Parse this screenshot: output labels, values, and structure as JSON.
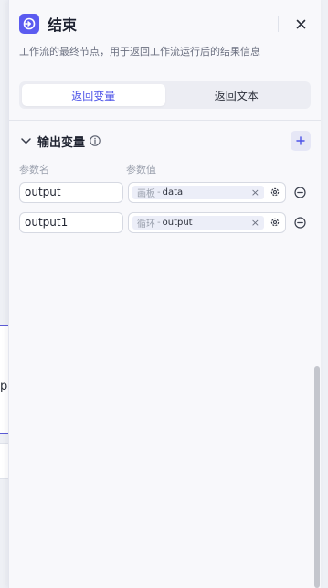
{
  "background": {
    "node_fragment_text": "p"
  },
  "panel": {
    "title": "结束",
    "description": "工作流的最终节点，用于返回工作流运行后的结果信息",
    "close_icon": "close-icon",
    "node_icon": "exit-node-icon",
    "accent_color": "#5b5bf0"
  },
  "tabs": [
    {
      "label": "返回变量",
      "active": true
    },
    {
      "label": "返回文本",
      "active": false
    }
  ],
  "output_section": {
    "title": "输出变量",
    "col_name": "参数名",
    "col_value": "参数值",
    "rows": [
      {
        "name": "output",
        "source": "画板",
        "separator": "-",
        "variable": "data"
      },
      {
        "name": "output1",
        "source": "循环",
        "separator": "-",
        "variable": "output"
      }
    ]
  }
}
